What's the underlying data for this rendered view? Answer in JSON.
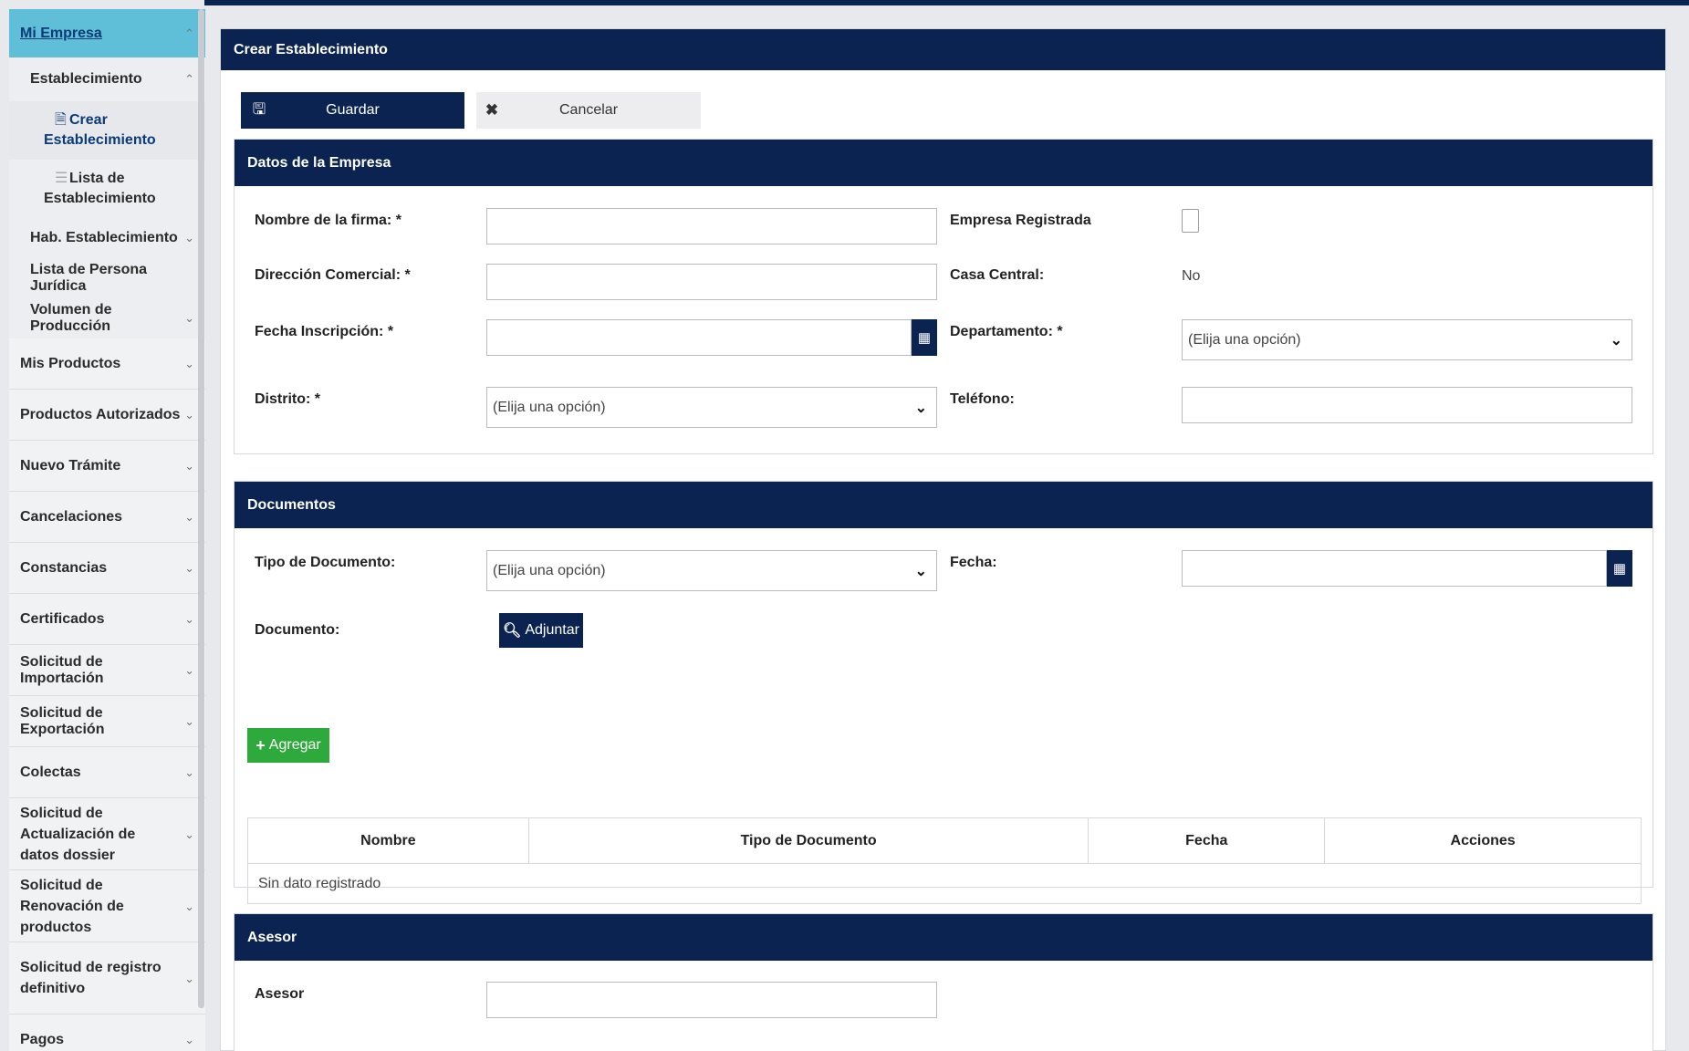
{
  "sidebar": {
    "header": "Mi Empresa",
    "establecimiento": "Establecimiento",
    "crear": [
      "Crear",
      "Establecimiento"
    ],
    "lista": [
      "Lista de",
      "Establecimiento"
    ],
    "sub_items": [
      "Hab. Establecimiento",
      "Lista de Persona Jurídica",
      "Volumen de Producción"
    ],
    "items": [
      "Mis Productos",
      "Productos Autorizados",
      "Nuevo Trámite",
      "Cancelaciones",
      "Constancias",
      "Certificados",
      "Solicitud de Importación",
      "Solicitud de Exportación",
      "Colectas"
    ],
    "tall_items": [
      [
        "Solicitud de Actualización de",
        "datos dossier"
      ],
      [
        "Solicitud de Renovación de",
        "productos"
      ],
      [
        "Solicitud de registro",
        "definitivo"
      ]
    ],
    "last_item": "Pagos"
  },
  "page": {
    "title": "Crear Establecimiento",
    "save_label": "Guardar",
    "cancel_label": "Cancelar"
  },
  "empresa": {
    "title": "Datos de la Empresa",
    "nombre_label": "Nombre de la firma: *",
    "registrada_label": "Empresa Registrada",
    "direccion_label": "Dirección Comercial: *",
    "casa_label": "Casa Central:",
    "casa_value": "No",
    "fecha_label": "Fecha Inscripción: *",
    "departamento_label": "Departamento: *",
    "departamento_value": "(Elija una opción)",
    "distrito_label": "Distrito: *",
    "distrito_value": "(Elija una opción)",
    "telefono_label": "Teléfono:"
  },
  "documentos": {
    "title": "Documentos",
    "tipo_label": "Tipo de Documento:",
    "tipo_value": "(Elija una opción)",
    "fecha_label": "Fecha:",
    "documento_label": "Documento:",
    "adjuntar_label": "Adjuntar",
    "agregar_label": "Agregar",
    "columns": [
      "Nombre",
      "Tipo de Documento",
      "Fecha",
      "Acciones"
    ],
    "empty": "Sin dato registrado"
  },
  "asesor": {
    "title": "Asesor",
    "label": "Asesor"
  },
  "colors": {
    "navy": "#0b2350",
    "sidebar_active": "#5fbfd8",
    "green": "#2eaa3c"
  }
}
